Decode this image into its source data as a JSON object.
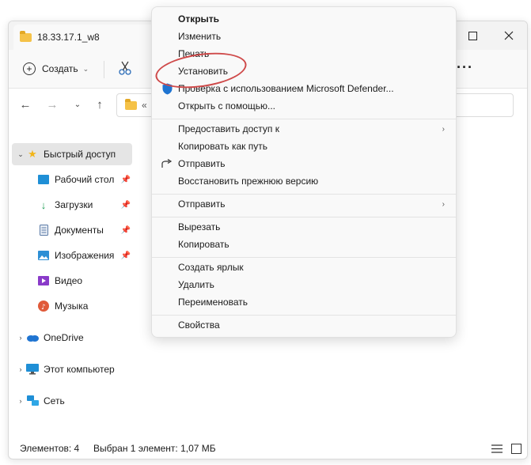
{
  "window": {
    "tab_title": "18.33.17.1_w8"
  },
  "toolbar": {
    "create_label": "Создать",
    "more": "···"
  },
  "address": {
    "text": "«"
  },
  "sidebar": {
    "items": [
      {
        "label": "Быстрый доступ",
        "icon": "star-icon"
      },
      {
        "label": "Рабочий стол",
        "icon": "desktop-icon"
      },
      {
        "label": "Загрузки",
        "icon": "download-icon"
      },
      {
        "label": "Документы",
        "icon": "documents-icon"
      },
      {
        "label": "Изображения",
        "icon": "pictures-icon"
      },
      {
        "label": "Видео",
        "icon": "video-icon"
      },
      {
        "label": "Музыка",
        "icon": "music-icon"
      },
      {
        "label": "OneDrive",
        "icon": "cloud-icon"
      },
      {
        "label": "Этот компьютер",
        "icon": "monitor-icon"
      },
      {
        "label": "Сеть",
        "icon": "network-icon"
      }
    ]
  },
  "status": {
    "items_count": "Элементов: 4",
    "selected": "Выбран 1 элемент: 1,07 МБ"
  },
  "context_menu": {
    "items": [
      "Открыть",
      "Изменить",
      "Печать",
      "Установить",
      "Проверка с использованием Microsoft Defender...",
      "Открыть с помощью...",
      "Предоставить доступ к",
      "Копировать как путь",
      "Отправить",
      "Восстановить прежнюю версию",
      "Отправить",
      "Вырезать",
      "Копировать",
      "Создать ярлык",
      "Удалить",
      "Переименовать",
      "Свойства"
    ]
  },
  "colors": {
    "annotation": "#cf4a4a",
    "accent": "#2a6bb8",
    "folder": "#f5c248"
  }
}
